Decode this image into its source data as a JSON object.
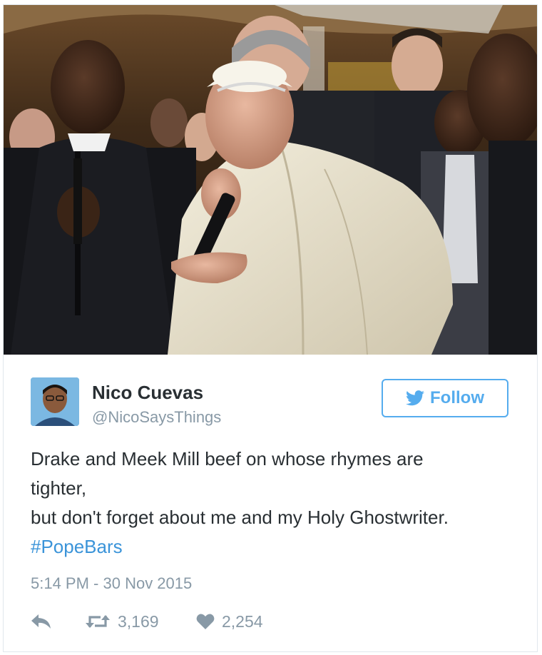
{
  "tweet": {
    "display_name": "Nico Cuevas",
    "screen_name": "@NicoSaysThings",
    "follow_label": "Follow",
    "text_lines": [
      "Drake and Meek Mill beef on whose rhymes are",
      "tighter,",
      "but don't forget about me and my Holy Ghostwriter."
    ],
    "hashtag": "#PopeBars",
    "timestamp": "5:14 PM - 30 Nov 2015",
    "retweet_count": "3,169",
    "like_count": "2,254"
  },
  "icons": {
    "follow": "twitter-bird-icon",
    "reply": "reply-icon",
    "retweet": "retweet-icon",
    "like": "heart-icon"
  },
  "colors": {
    "accent": "#55acee",
    "hashtag": "#3b94d9",
    "muted": "#8899a6",
    "text": "#292f33"
  }
}
